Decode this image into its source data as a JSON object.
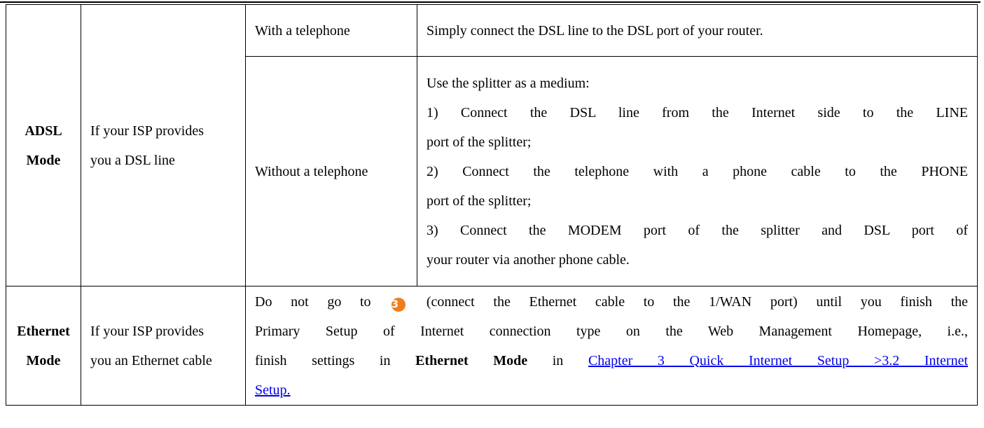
{
  "adsl": {
    "mode_line1": "ADSL",
    "mode_line2": "Mode",
    "condition_line1": "If your ISP provides",
    "condition_line2": "you a DSL line",
    "with_telephone": {
      "label": "With a telephone",
      "description": "Simply connect the DSL line to the DSL port of your router."
    },
    "without_telephone": {
      "label": "Without a telephone",
      "lines": [
        "Use the splitter as a medium:",
        "1) Connect the DSL line from the Internet side to the LINE",
        "port of the splitter;",
        "2) Connect the telephone with a phone cable to the PHONE",
        "port of the splitter;",
        "3) Connect the MODEM port of the splitter and DSL port of",
        "your router via another phone cable."
      ]
    }
  },
  "ethernet": {
    "mode_line1": "Ethernet",
    "mode_line2": "Mode",
    "condition_line1": "If your ISP provides",
    "condition_line2": "you an Ethernet cable",
    "desc": {
      "l1_before": "Do not go to",
      "step_badge": "3",
      "l1_after": "(connect the Ethernet cable to the 1/WAN port) until you finish the",
      "l2": "Primary Setup of Internet connection type on the Web Management Homepage, i.e.,",
      "l3_before": "finish settings in",
      "l3_bold": "Ethernet Mode",
      "l3_mid": "in",
      "link_part1": "Chapter 3 Quick Internet Setup >3.2 Internet",
      "link_part2": "Setup."
    }
  }
}
